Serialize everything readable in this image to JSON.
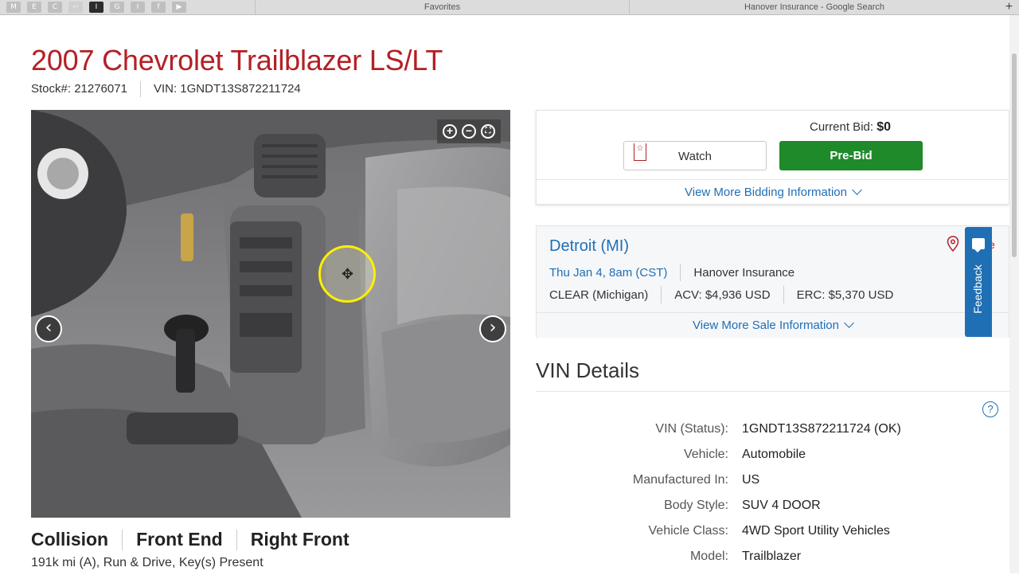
{
  "browser": {
    "favorites_icons": [
      {
        "letter": "M",
        "name": "m-favicon"
      },
      {
        "letter": "E",
        "name": "e-favicon"
      },
      {
        "letter": "C",
        "name": "c-favicon"
      },
      {
        "letter": "↩",
        "name": "back-favicon"
      },
      {
        "letter": "I",
        "name": "i-favicon-active"
      },
      {
        "letter": "G",
        "name": "g-favicon"
      },
      {
        "letter": "I",
        "name": "i-favicon"
      },
      {
        "letter": "f",
        "name": "facebook-favicon"
      },
      {
        "letter": "▶",
        "name": "youtube-favicon"
      }
    ],
    "tab1_title": "Favorites",
    "tab2_title": "Hanover Insurance - Google Search",
    "new_tab": "+"
  },
  "lot": {
    "title": "2007 Chevrolet Trailblazer LS/LT",
    "stock": "Stock#: 21276071",
    "vin": "VIN: 1GNDT13S872211724",
    "damage_primary": "Collision",
    "damage_secondary": "Front End",
    "damage_tertiary": "Right Front",
    "status": "191k mi (A), Run & Drive, Key(s) Present"
  },
  "photo": {
    "zoom_in": "+",
    "zoom_out": "−",
    "fullscreen": "⛶",
    "prev": "‹",
    "next": "›",
    "cursor": "✥"
  },
  "bid": {
    "current_label": "Current Bid:",
    "current_value": "$0",
    "watch_label": "Watch",
    "prebid_label": "Pre-Bid",
    "more_label": "View More Bidding Information"
  },
  "sale": {
    "city": "Detroit (MI)",
    "date": "Thu Jan 4, 8am (CST)",
    "seller": "Hanover Insurance",
    "title_status": "CLEAR (Michigan)",
    "acv": "ACV: $4,936 USD",
    "erc": "ERC: $5,370 USD",
    "cut_text": "e",
    "more_label": "View More Sale Information"
  },
  "feedback": {
    "label": "Feedback"
  },
  "vin_details": {
    "title": "VIN Details",
    "help": "?",
    "rows": [
      {
        "key": "VIN (Status):",
        "value": "1GNDT13S872211724 (OK)"
      },
      {
        "key": "Vehicle:",
        "value": "Automobile"
      },
      {
        "key": "Manufactured In:",
        "value": "US"
      },
      {
        "key": "Body Style:",
        "value": "SUV 4 DOOR"
      },
      {
        "key": "Vehicle Class:",
        "value": "4WD Sport Utility Vehicles"
      },
      {
        "key": "Model:",
        "value": "Trailblazer"
      }
    ]
  },
  "colors": {
    "brand_red": "#b32025",
    "link_blue": "#1f6fb5",
    "prebid_green": "#1e8a2a"
  }
}
